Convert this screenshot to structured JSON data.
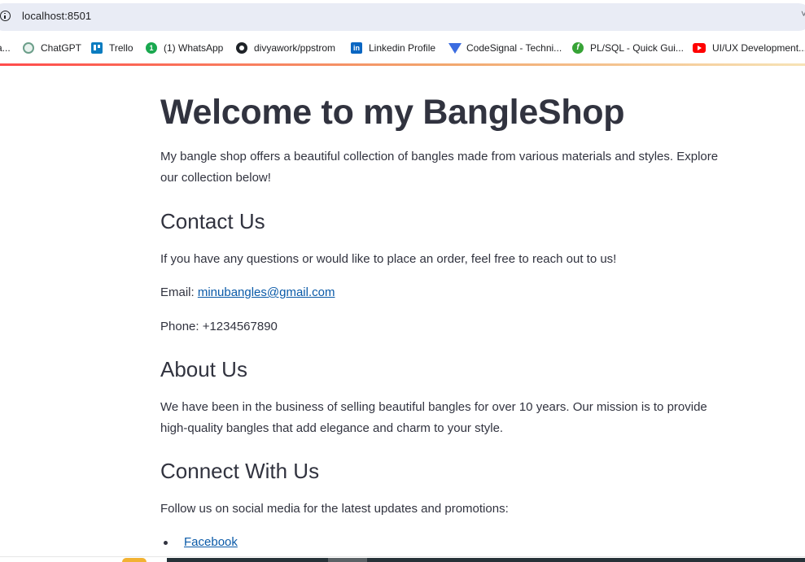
{
  "browser": {
    "url": "localhost:8501",
    "bookmarks": [
      {
        "label": "a...",
        "icon": "page-icon"
      },
      {
        "label": "ChatGPT",
        "icon": "chatgpt-icon"
      },
      {
        "label": "Trello",
        "icon": "trello-icon"
      },
      {
        "label": "(1) WhatsApp",
        "icon": "whatsapp-icon"
      },
      {
        "label": "divyawork/ppstrom",
        "icon": "github-icon"
      },
      {
        "label": "Linkedin Profile",
        "icon": "linkedin-icon"
      },
      {
        "label": "CodeSignal - Techni...",
        "icon": "codesignal-icon"
      },
      {
        "label": "PL/SQL - Quick Gui...",
        "icon": "plsql-icon"
      },
      {
        "label": "UI/UX Development...",
        "icon": "youtube-icon"
      }
    ]
  },
  "page": {
    "title": "Welcome to my BangleShop",
    "intro": "My bangle shop offers a beautiful collection of bangles made from various materials and styles. Explore our collection below!",
    "contact": {
      "heading": "Contact Us",
      "text": "If you have any questions or would like to place an order, feel free to reach out to us!",
      "email_label": "Email: ",
      "email": "minubangles@gmail.com",
      "phone": "Phone: +1234567890"
    },
    "about": {
      "heading": "About Us",
      "text": "We have been in the business of selling beautiful bangles for over 10 years. Our mission is to provide high-quality bangles that add elegance and charm to your style."
    },
    "connect": {
      "heading": "Connect With Us",
      "text": "Follow us on social media for the latest updates and promotions:",
      "links": [
        "Facebook"
      ]
    }
  },
  "colors": {
    "text": "#31333f",
    "link": "#0a5aa8",
    "accent_start": "#ff4b4b",
    "accent_end": "#f7e3b6"
  }
}
